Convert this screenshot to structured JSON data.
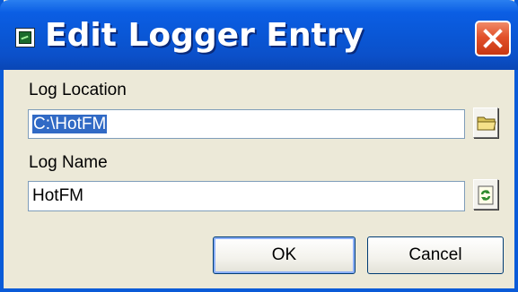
{
  "window": {
    "title": "Edit Logger Entry"
  },
  "icons": {
    "app": "logger-app-icon",
    "close": "close-icon",
    "browse": "folder-icon",
    "refresh": "refresh-icon"
  },
  "form": {
    "location_label": "Log Location",
    "location_value": "C:\\HotFM",
    "name_label": "Log Name",
    "name_value": "HotFM"
  },
  "buttons": {
    "ok": "OK",
    "cancel": "Cancel"
  },
  "colors": {
    "title_bar": "#0a57d6",
    "close_button": "#e2512b",
    "dialog_bg": "#ece9d8",
    "selection": "#316ac5"
  }
}
